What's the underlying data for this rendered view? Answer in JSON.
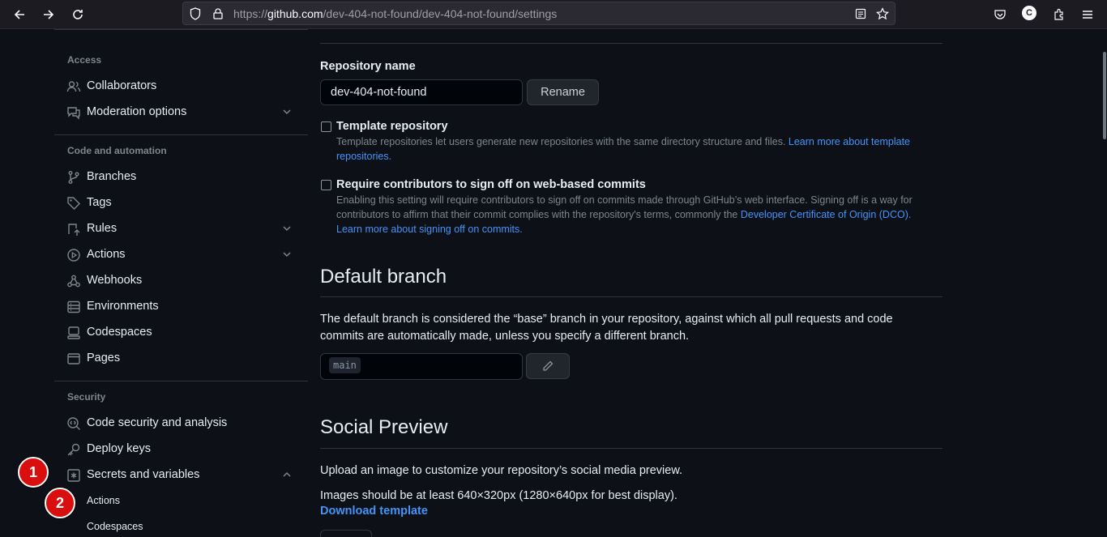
{
  "browser": {
    "url_prefix": "https://",
    "url_domain": "github.com",
    "url_path": "/dev-404-not-found/dev-404-not-found/settings",
    "profile_initial": "C"
  },
  "sidebar": {
    "access_heading": "Access",
    "collaborators": "Collaborators",
    "moderation": "Moderation options",
    "code_heading": "Code and automation",
    "branches": "Branches",
    "tags": "Tags",
    "rules": "Rules",
    "actions": "Actions",
    "webhooks": "Webhooks",
    "environments": "Environments",
    "codespaces": "Codespaces",
    "pages": "Pages",
    "security_heading": "Security",
    "code_security": "Code security and analysis",
    "deploy_keys": "Deploy keys",
    "secrets": "Secrets and variables",
    "sub_actions": "Actions",
    "sub_codespaces": "Codespaces"
  },
  "badges": {
    "one": "1",
    "two": "2"
  },
  "general": {
    "repo_name_label": "Repository name",
    "repo_name_value": "dev-404-not-found",
    "rename_button": "Rename",
    "template_title": "Template repository",
    "template_desc": "Template repositories let users generate new repositories with the same directory structure and files. ",
    "template_link": "Learn more about template repositories.",
    "signoff_title": "Require contributors to sign off on web-based commits",
    "signoff_desc": "Enabling this setting will require contributors to sign off on commits made through GitHub’s web interface. Signing off is a way for contributors to affirm that their commit complies with the repository's terms, commonly the ",
    "signoff_link1": "Developer Certificate of Origin (DCO).",
    "signoff_link2": "Learn more about signing off on commits."
  },
  "default_branch": {
    "heading": "Default branch",
    "description": "The default branch is considered the “base” branch in your repository, against which all pull requests and code commits are automatically made, unless you specify a different branch.",
    "branch_value": "main"
  },
  "social_preview": {
    "heading": "Social Preview",
    "line1": "Upload an image to customize your repository’s social media preview.",
    "line2": "Images should be at least 640×320px (1280×640px for best display).",
    "download_link": "Download template"
  }
}
